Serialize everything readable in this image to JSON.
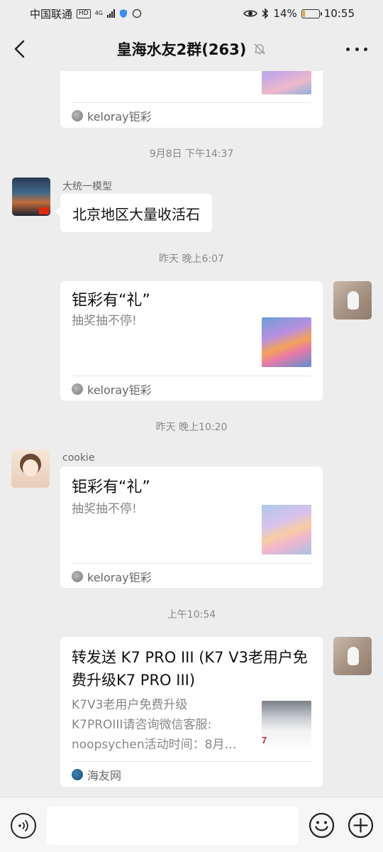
{
  "status_bar": {
    "carrier": "中国联通",
    "hd_badge": "HD",
    "network": "4G",
    "battery_percent": "14%",
    "battery_level": 0.14,
    "time": "10:55"
  },
  "header": {
    "title": "皇海水友2群(263)",
    "back_icon": "chevron-left-icon",
    "mute_icon": "bell-off-icon",
    "more_icon": "more-dots-icon"
  },
  "messages": [
    {
      "type": "link_card_partial",
      "source": "keloray钜彩"
    },
    {
      "type": "timestamp",
      "text": "9月8日 下午14:37"
    },
    {
      "type": "text",
      "sender": "大统一模型",
      "text": "北京地区大量收活石"
    },
    {
      "type": "timestamp",
      "text": "昨天 晚上6:07"
    },
    {
      "type": "link_card",
      "title": "钜彩有“礼”",
      "desc": "抽奖抽不停!",
      "source": "keloray钜彩"
    },
    {
      "type": "timestamp",
      "text": "昨天 晚上10:20"
    },
    {
      "type": "link_card",
      "sender": "cookie",
      "title": "钜彩有“礼”",
      "desc": "抽奖抽不停!",
      "source": "keloray钜彩"
    },
    {
      "type": "timestamp",
      "text": "上午10:54"
    },
    {
      "type": "link_card",
      "title": "转发送 K7 PRO III (K7 V3老用户免费升级K7 PRO III)",
      "desc_lines": [
        "K7V3老用户免费升级",
        "K7PROIII请咨询微信客服:",
        "noopsychen活动时间：8月…"
      ],
      "source": "海友网"
    }
  ],
  "input_bar": {
    "voice_icon": "voice-icon",
    "emoji_icon": "emoji-icon",
    "plus_icon": "plus-circle-icon"
  },
  "colors": {
    "background": "#ededed",
    "bubble": "#ffffff",
    "timestamp": "#888888"
  }
}
